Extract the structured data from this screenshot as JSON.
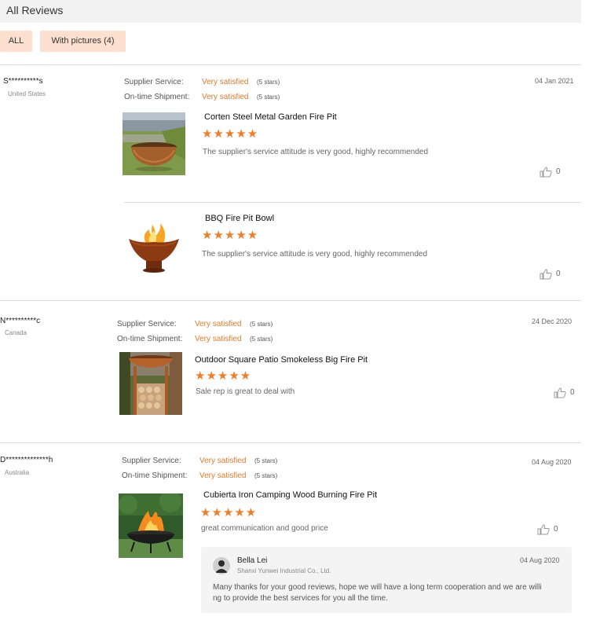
{
  "header": {
    "title": "All Reviews"
  },
  "filters": {
    "all": "ALL",
    "with_pictures": "With pictures (4)"
  },
  "labels": {
    "supplier_service": "Supplier Service:",
    "on_time_shipment": "On-time Shipment:"
  },
  "reviews": [
    {
      "user": "S**********s",
      "country": "United States",
      "date": "04 Jan 2021",
      "supplier_service": "Very satisfied",
      "supplier_service_stars": "(5 stars)",
      "on_time_shipment": "Very satisfied",
      "on_time_shipment_stars": "(5 stars)",
      "items": [
        {
          "product": "Corten Steel Metal Garden Fire Pit",
          "rating": 5,
          "stars": "★★★★★",
          "comment": "The supplier's service attitude is very good, highly recommended",
          "likes": "0"
        },
        {
          "product": "BBQ Fire Pit Bowl",
          "rating": 5,
          "stars": "★★★★★",
          "comment": "The supplier's service attitude is very good, highly recommended",
          "likes": "0"
        }
      ]
    },
    {
      "user": "N**********c",
      "country": "Canada",
      "date": "24 Dec 2020",
      "supplier_service": "Very satisfied",
      "supplier_service_stars": "(5 stars)",
      "on_time_shipment": "Very satisfied",
      "on_time_shipment_stars": "(5 stars)",
      "items": [
        {
          "product": "Outdoor Square Patio Smokeless Big Fire Pit",
          "rating": 5,
          "stars": "★★★★★",
          "comment": "Sale rep is great to deal with",
          "likes": "0"
        }
      ]
    },
    {
      "user": "D**************h",
      "country": "Australia",
      "date": "04 Aug 2020",
      "supplier_service": "Very satisfied",
      "supplier_service_stars": "(5 stars)",
      "on_time_shipment": "Very satisfied",
      "on_time_shipment_stars": "(5 stars)",
      "items": [
        {
          "product": "Cubierta Iron Camping Wood Burning Fire Pit",
          "rating": 5,
          "stars": "★★★★★",
          "comment": "great communication and good price",
          "likes": "0"
        }
      ],
      "reply": {
        "name": "Bella Lei",
        "company": "Shanxi Yunwei Industrial Co., Ltd.",
        "date": "04 Aug 2020",
        "text_line1": "Many thanks for your good reviews, hope we will have a long term cooperation and we are willi",
        "text_line2": "ng to provide the best services for you all the time."
      }
    }
  ],
  "colors": {
    "accent": "#e07b28",
    "star": "#f07e26",
    "filter_bg": "#fde0d0"
  },
  "icons": {
    "like": "thumbs-up-icon",
    "avatar": "user-avatar-icon"
  }
}
